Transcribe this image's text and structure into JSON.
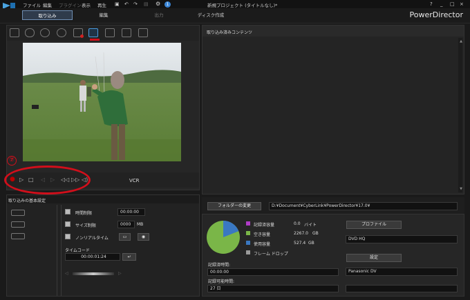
{
  "menu": {
    "file": "ファイル",
    "edit": "編集",
    "plugin": "プラグイン",
    "view": "表示",
    "play": "再生"
  },
  "title": "新規プロジェクト (タイトルなし)*",
  "brand": "PowerDirector",
  "window": {
    "help": "?",
    "minimize": "_",
    "maximize": "□",
    "close": "×"
  },
  "tabs": [
    {
      "label": "取り込み",
      "state": "active"
    },
    {
      "label": "編集",
      "state": "normal"
    },
    {
      "label": "出力",
      "state": "disabled"
    },
    {
      "label": "ディスク作成",
      "state": "normal"
    }
  ],
  "transport": {
    "mode": "VCR"
  },
  "annotation": {
    "number": "⑦"
  },
  "capture": {
    "title": "取り込みの基本設定",
    "time_limit_label": "時間制限",
    "time_limit_value": "00:00:00",
    "size_limit_label": "サイズ制限",
    "size_limit_value": "0000",
    "size_unit": "MB",
    "nonrealtime_label": "ノンリアルタイム",
    "timecode_label": "タイムコード",
    "timecode_value": "00:00:01:24"
  },
  "content": {
    "title": "取り込み済みコンテンツ"
  },
  "folder": {
    "button": "フォルダーの変更",
    "path": "D:¥Document¥CyberLink¥PowerDirector¥17.0¥"
  },
  "disk": {
    "recorded_label": "記録済容量",
    "recorded_value": "0.0",
    "recorded_unit": "バイト",
    "free_label": "空き容量",
    "free_value": "2267.0",
    "free_unit": "GB",
    "used_label": "使用容量",
    "used_value": "527.4",
    "used_unit": "GB",
    "dropped_label": "フレーム ドロップ",
    "colors": {
      "recorded": "#b03cc8",
      "free": "#7ab648",
      "used": "#3a78c2",
      "dropped": "#9a9a9a"
    },
    "pie": {
      "free_fraction": 0.81,
      "used_fraction": 0.19
    }
  },
  "profile": {
    "button": "プロファイル",
    "value": "DVD HQ"
  },
  "settings": {
    "button": "設定",
    "value": "Panasonic DV"
  },
  "rec_time": {
    "label": "記録済時間:",
    "value": "00:00:00"
  },
  "rec_avail": {
    "label": "記録可能時間:",
    "value": "27 日"
  }
}
